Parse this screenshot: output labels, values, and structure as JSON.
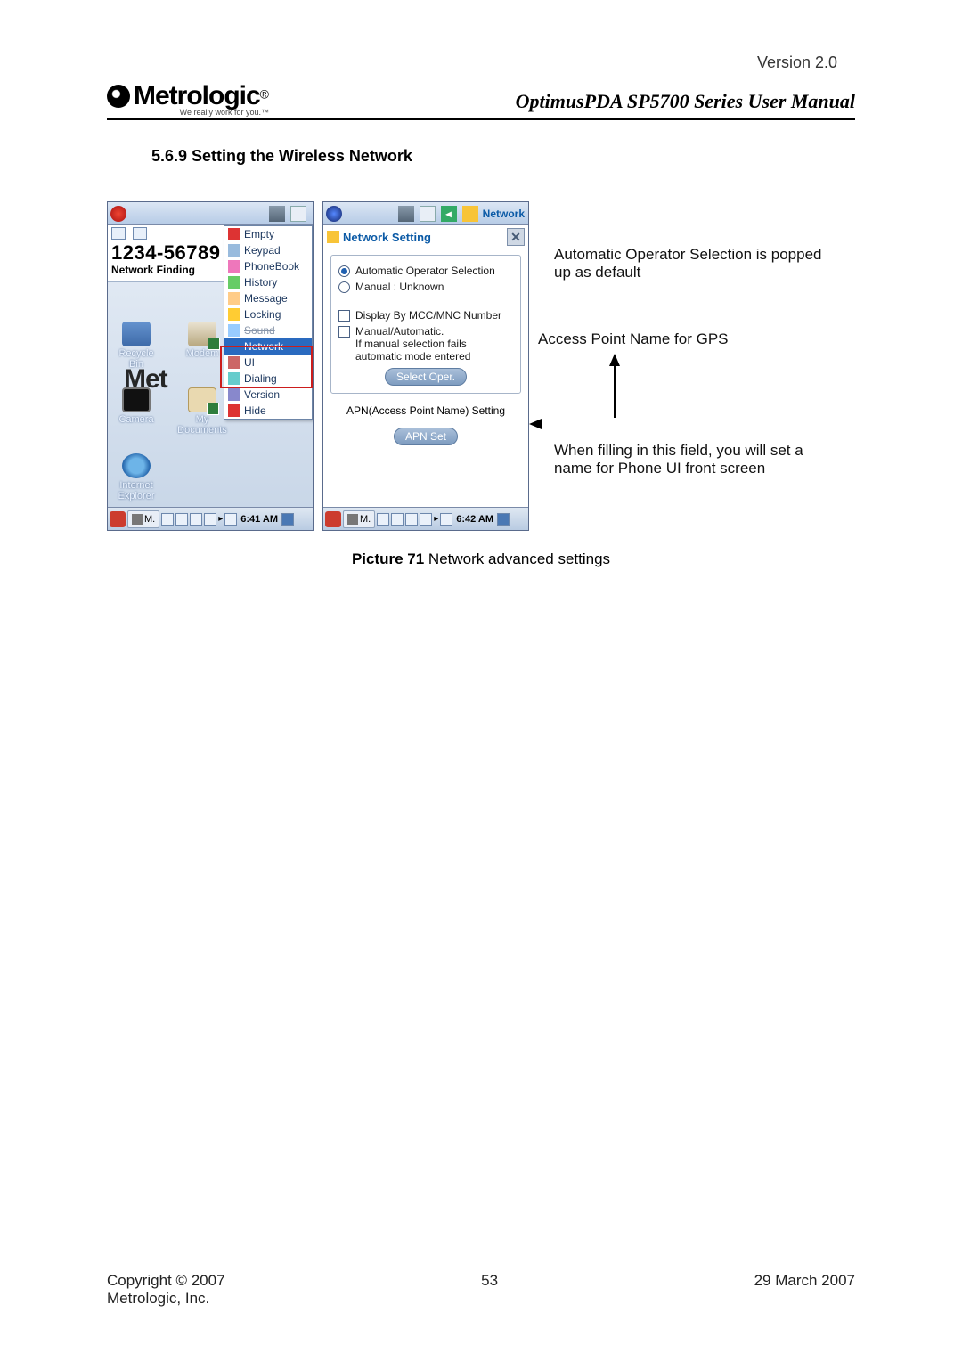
{
  "page": {
    "version_label": "Version 2.0",
    "logo_name": "Metrologic",
    "logo_reg": "®",
    "tagline": "We really work for you.™",
    "manual_title": "OptimusPDA SP5700 Series User Manual",
    "section_heading": "5.6.9 Setting the Wireless Network",
    "caption_bold": "Picture 71",
    "caption_rest": " Network advanced settings"
  },
  "screenshot1": {
    "dialed_number": "1234-56789",
    "network_status": "Network Finding",
    "desktop_icons": {
      "recycle_bin": "Recycle Bin",
      "modem": "Modem",
      "camera": "Camera",
      "my_documents": "My Documents",
      "ie_line1": "Internet",
      "ie_line2": "Explorer"
    },
    "menu": {
      "empty": "Empty",
      "keypad": "Keypad",
      "phonebook": "PhoneBook",
      "history": "History",
      "message": "Message",
      "locking": "Locking",
      "sound": "Sound",
      "network": "Network",
      "ui": "UI",
      "dialing": "Dialing",
      "version": "Version",
      "hide": "Hide"
    },
    "taskbar_time": "6:41 AM",
    "taskbar_btn": "M."
  },
  "screenshot2": {
    "titlebar": "Network",
    "window_title": "Network Setting",
    "auto_oper": "Automatic Operator Selection",
    "manual_oper": "Manual : Unknown",
    "display_mcc": "Display By MCC/MNC Number",
    "manual_auto_l1": "Manual/Automatic.",
    "manual_auto_l2": "If manual selection fails",
    "manual_auto_l3": "automatic mode entered",
    "select_oper_btn": "Select Oper.",
    "apn_label": "APN(Access Point Name) Setting",
    "apn_btn": "APN Set",
    "taskbar_time": "6:42 AM",
    "taskbar_btn": "M."
  },
  "annotations": {
    "a1": "Automatic Operator Selection is popped up as  default",
    "a2": "Access Point Name for GPS",
    "a3": "When filling in this field, you will set a name for Phone UI front screen"
  },
  "footer": {
    "left_l1": "Copyright © 2007",
    "left_l2": "Metrologic, Inc.",
    "center": "53",
    "right": "29 March 2007"
  }
}
